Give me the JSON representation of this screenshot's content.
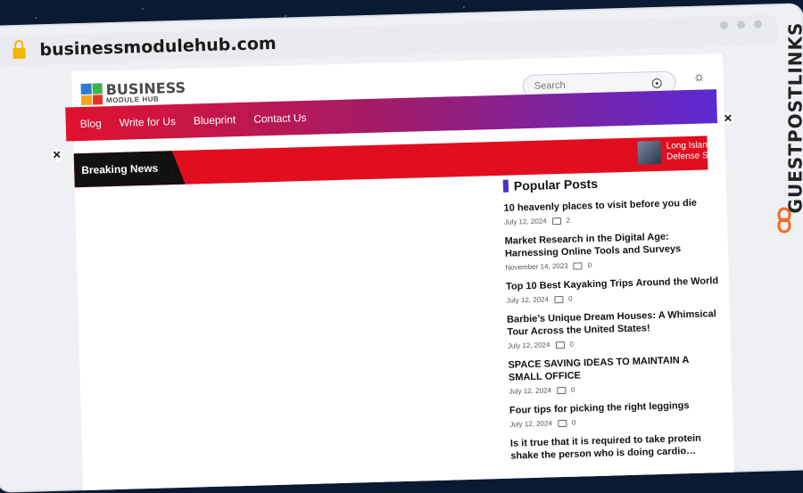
{
  "browser": {
    "url": "businessmodulehub.com"
  },
  "logo": {
    "line1": "BUSINESS",
    "line2": "MODULE HUB"
  },
  "search": {
    "placeholder": "Search"
  },
  "nav": {
    "items": [
      "Blog",
      "Write for Us",
      "Blueprint",
      "Contact Us"
    ]
  },
  "breaking": {
    "label": "Breaking News",
    "ticker_line1": "Long Island",
    "ticker_line2": "Defense St"
  },
  "popular": {
    "heading": "Popular Posts",
    "posts": [
      {
        "title": "10 heavenly places to visit before you die",
        "date": "July 12, 2024",
        "comments": "2"
      },
      {
        "title": "Market Research in the Digital Age: Harnessing Online Tools and Surveys",
        "date": "November 14, 2023",
        "comments": "0"
      },
      {
        "title": "Top 10 Best Kayaking Trips Around the World",
        "date": "July 12, 2024",
        "comments": "0"
      },
      {
        "title": "Barbie’s Unique Dream Houses: A Whimsical Tour Across the United States!",
        "date": "July 12, 2024",
        "comments": "0"
      },
      {
        "title": "SPACE SAVING IDEAS TO MAINTAIN A SMALL OFFICE",
        "date": "July 12, 2024",
        "comments": "0"
      },
      {
        "title": "Four tips for picking the right leggings",
        "date": "July 12, 2024",
        "comments": "0"
      },
      {
        "title": "Is it true that it is required to take protein shake the person who is doing cardio…",
        "date": "",
        "comments": ""
      }
    ]
  },
  "brand": {
    "text": "GUESTPOSTLINKS"
  },
  "icons": {
    "lock": "lock-icon",
    "search": "target-icon",
    "theme": "theme-toggle-icon",
    "close": "close-icon"
  }
}
